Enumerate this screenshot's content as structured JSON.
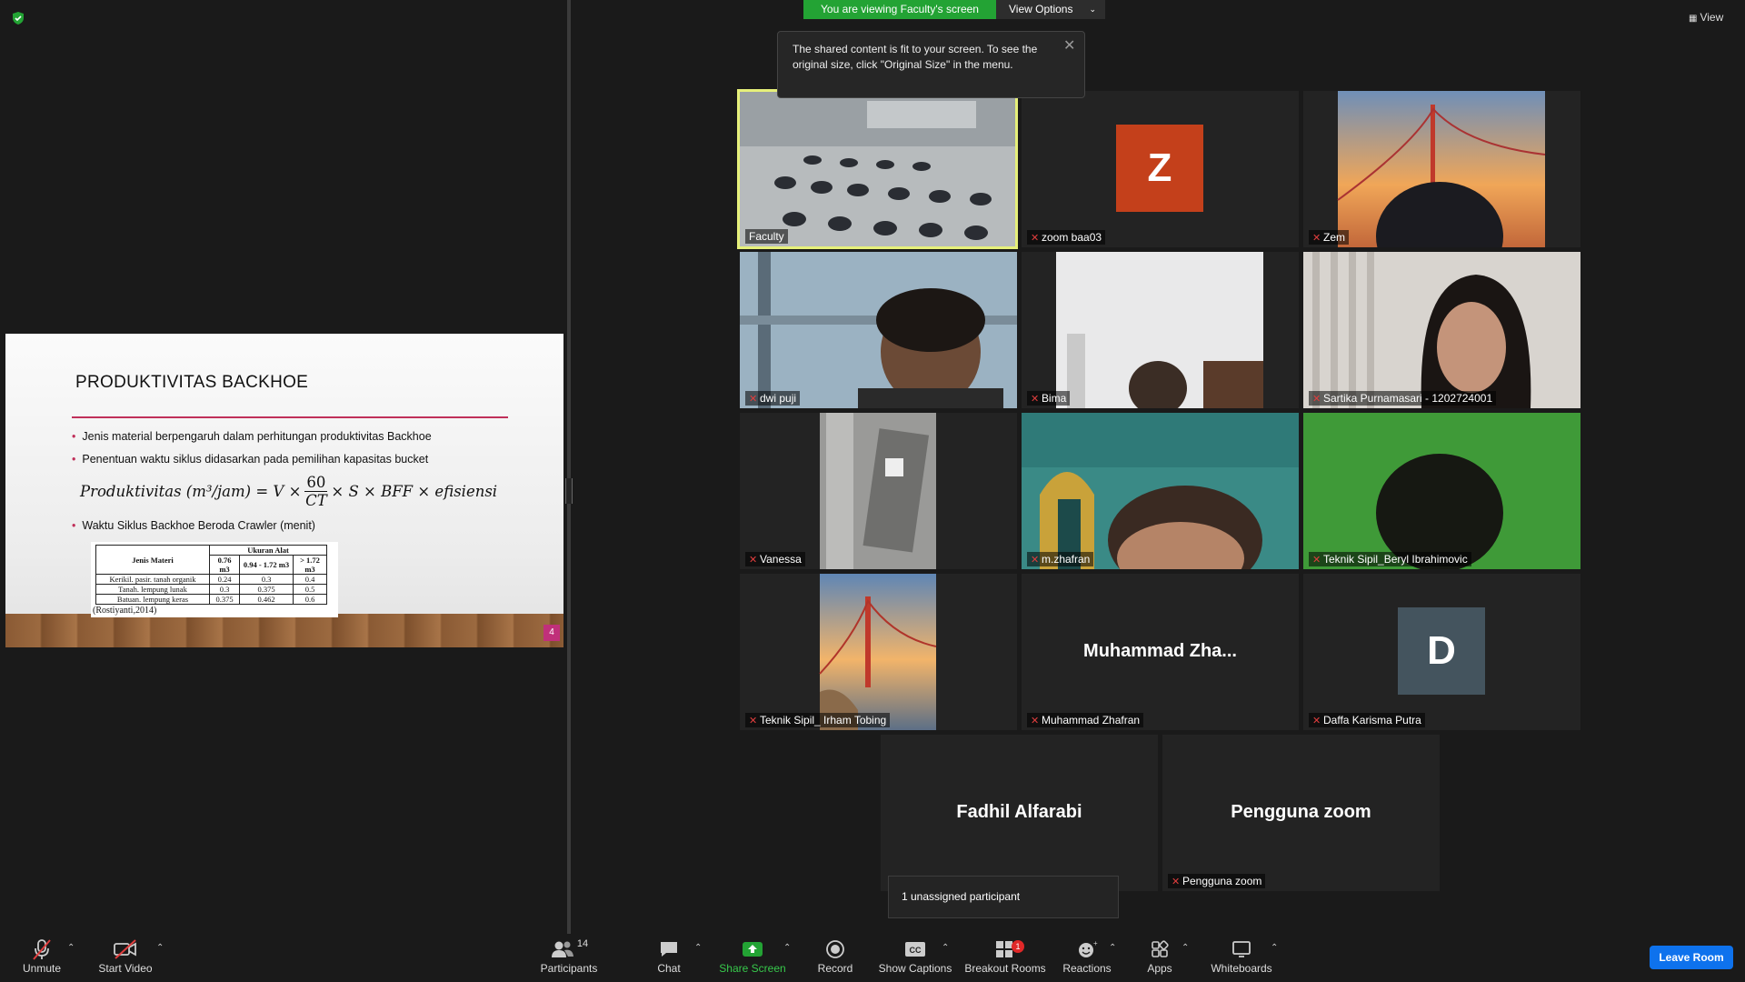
{
  "banner": {
    "viewing": "You are viewing Faculty's screen",
    "view_options": "View Options"
  },
  "view_button": "View",
  "tooltip": {
    "text": "The shared content is fit to your screen. To see the original size, click \"Original Size\" in the menu."
  },
  "slide": {
    "title": "PRODUKTIVITAS BACKHOE",
    "bullets": [
      "Jenis material berpengaruh dalam perhitungan produktivitas Backhoe",
      "Penentuan waktu siklus didasarkan pada pemilihan kapasitas bucket",
      "Waktu Siklus Backhoe Beroda Crawler (menit)"
    ],
    "formula": {
      "left": "Produktivitas (m³/jam) = V ×",
      "num": "60",
      "den": "CT",
      "right": "× S × BFF × efisiensi"
    },
    "table": {
      "col1": "Jenis Materi",
      "group": "Ukuran Alat",
      "subcols": [
        "0.76 m3",
        "0.94 - 1.72 m3",
        "> 1.72 m3"
      ],
      "rows": [
        {
          "label": "Kerikil. pasir. tanah organik",
          "v": [
            "0.24",
            "0.3",
            "0.4"
          ]
        },
        {
          "label": "Tanah. lempung lunak",
          "v": [
            "0.3",
            "0.375",
            "0.5"
          ]
        },
        {
          "label": "Batuan. lempung keras",
          "v": [
            "0.375",
            "0.462",
            "0.6"
          ]
        }
      ],
      "source": "(Rostiyanti,2014)"
    },
    "page_number": "4"
  },
  "tiles": [
    {
      "name": "Faculty"
    },
    {
      "name": "zoom baa03",
      "avatar": "Z",
      "avatar_color": "#c4401b"
    },
    {
      "name": "Zem"
    },
    {
      "name": "dwi puji"
    },
    {
      "name": "Bima"
    },
    {
      "name": "Sartika Purnamasari - 1202724001"
    },
    {
      "name": "Vanessa"
    },
    {
      "name": "m.zhafran"
    },
    {
      "name": "Teknik Sipil_Beryl Ibrahimovic"
    },
    {
      "name": "Teknik Sipil_ Irham Tobing"
    },
    {
      "name": "Muhammad Zhafran",
      "big": "Muhammad  Zha..."
    },
    {
      "name": "Daffa Karisma Putra",
      "avatar": "D",
      "avatar_color": "#44545e"
    },
    {
      "name": "",
      "big": "Fadhil Alfarabi"
    },
    {
      "name": "Pengguna zoom",
      "big": "Pengguna zoom"
    }
  ],
  "unassigned": "1 unassigned participant",
  "toolbar": {
    "unmute": "Unmute",
    "start_video": "Start Video",
    "participants": "Participants",
    "participants_count": "14",
    "chat": "Chat",
    "share_screen": "Share Screen",
    "record": "Record",
    "show_captions": "Show Captions",
    "breakout_rooms": "Breakout Rooms",
    "breakout_badge": "1",
    "reactions": "Reactions",
    "apps": "Apps",
    "whiteboards": "Whiteboards",
    "leave_room": "Leave Room"
  },
  "colors": {
    "share_green": "#23a334",
    "leave_blue": "#0e72ed",
    "active_speaker": "#e6f07a",
    "accent": "#c0305a"
  }
}
